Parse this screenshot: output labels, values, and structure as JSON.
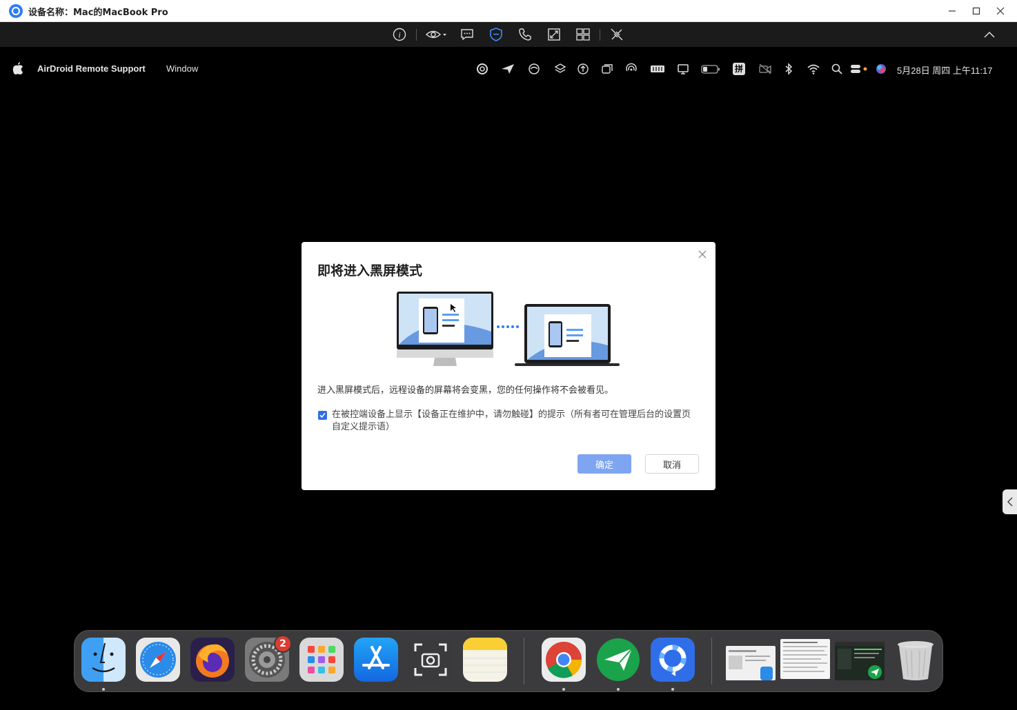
{
  "window": {
    "title": "设备名称：Mac的MacBook Pro"
  },
  "toolbar": {
    "icons": [
      "info-icon",
      "eye-icon",
      "chat-icon",
      "black-screen-icon",
      "phone-icon",
      "fit-screen-icon",
      "keys-icon",
      "disconnect-icon",
      "collapse-icon"
    ]
  },
  "menubar": {
    "app_name": "AirDroid Remote Support",
    "window_menu": "Window",
    "clock": "5月28日 周四 上午11:17",
    "input_method": "拼"
  },
  "dialog": {
    "title": "即将进入黑屏模式",
    "description": "进入黑屏模式后，远程设备的屏幕将会变黑，您的任何操作将不会被看见。",
    "checkbox_checked": true,
    "checkbox_label": "在被控端设备上显示【设备正在维护中，请勿触碰】的提示（所有者可在管理后台的设置页自定义提示语）",
    "confirm_label": "确定",
    "cancel_label": "取消"
  },
  "dock": {
    "items": [
      "finder",
      "safari",
      "firefox",
      "system-settings",
      "launchpad",
      "app-store",
      "screenshot",
      "notes",
      "chrome",
      "airdroid",
      "airdroid-remote-support",
      "window-thumb-1",
      "window-thumb-2",
      "window-thumb-3",
      "trash"
    ],
    "settings_badge": "2"
  },
  "colors": {
    "accent": "#2f6ee8",
    "confirm_button": "#7ea5f2"
  }
}
